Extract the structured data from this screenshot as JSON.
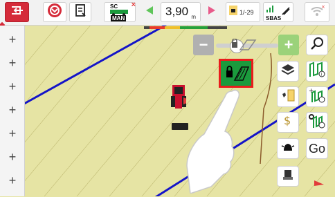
{
  "toolbar": {
    "speed_value": "3,90",
    "speed_unit": "m",
    "steering_mode": "SC",
    "steering_mode_sub": "MAN",
    "section_count": "1/-29",
    "signal": "SBAS"
  },
  "right_panel": {
    "go_label": "Go"
  },
  "left_panel": {
    "plus_signs": [
      "+",
      "+",
      "+",
      "+",
      "+",
      "+",
      "+"
    ]
  },
  "icons": [
    "exit-icon",
    "steering-wheel-icon",
    "notepad-icon",
    "tractor-icon",
    "arrow-left-icon",
    "arrow-right-icon",
    "sections-icon",
    "gps-signal-icon",
    "wifi-icon",
    "magnifier-icon",
    "layers-icon",
    "field-info-icon",
    "workrule-icon",
    "implement-icon",
    "lock-field-icon",
    "go-icon"
  ],
  "colors": {
    "accent_red": "#d52b3a",
    "field": "#e6e4a4",
    "guidance_line": "#1414c8",
    "lock_green": "#1b9a3d",
    "highlight": "#ea1c1c"
  }
}
